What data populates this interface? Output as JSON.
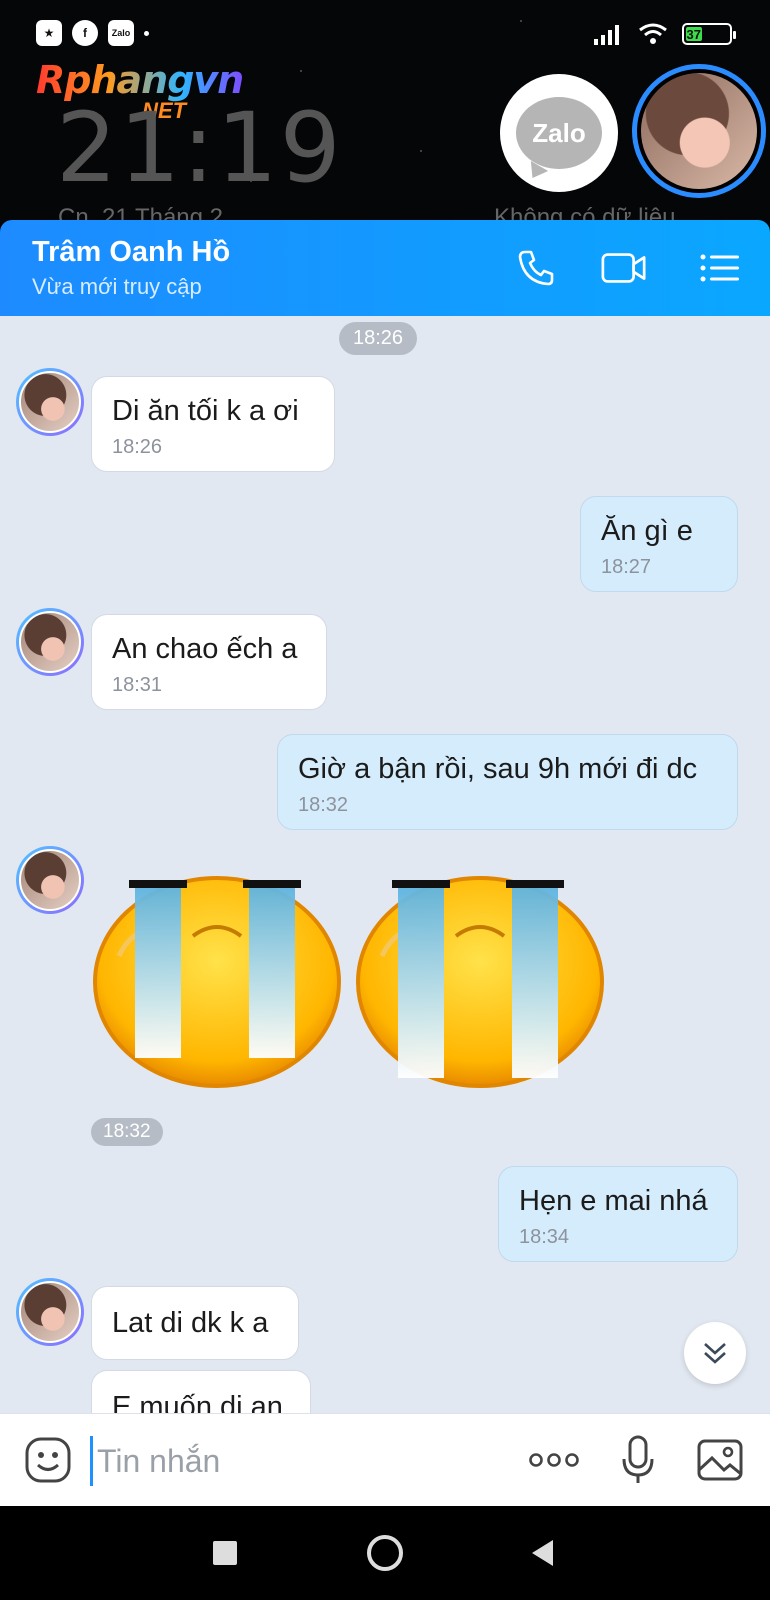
{
  "status_bar": {
    "battery_level": "37",
    "battery_fraction": 0.37,
    "left_icons": [
      "star-app-icon",
      "facebook-icon",
      "zalo-small-icon"
    ],
    "right_icons": [
      "signal-icon",
      "wifi-icon",
      "battery-icon"
    ]
  },
  "lockscreen": {
    "watermark_main": "Rphangvn",
    "watermark_sub": ".NET",
    "clock": "21:19",
    "date": "Cn, 21 Tháng 2",
    "no_data": "Không có dữ liệu"
  },
  "floating": {
    "zalo_label": "Zalo"
  },
  "header": {
    "contact_name": "Trâm Oanh Hồ",
    "status": "Vừa mới truy cập"
  },
  "messages": [
    {
      "kind": "time",
      "text": "18:26"
    },
    {
      "kind": "in",
      "text": "Di ăn tối k a ơi",
      "time": "18:26"
    },
    {
      "kind": "out",
      "text": "Ăn gì e",
      "time": "18:27"
    },
    {
      "kind": "in",
      "text": "An chao ếch a",
      "time": "18:31"
    },
    {
      "kind": "out",
      "text": "Giờ a bận rồi, sau 9h mới đi dc",
      "time": "18:32"
    },
    {
      "kind": "stickers",
      "time": "18:32",
      "sticker_names": [
        "crying-face-sticker",
        "crying-face-sticker"
      ]
    },
    {
      "kind": "out",
      "text": "Hẹn e mai nhá",
      "time": "18:34"
    },
    {
      "kind": "in",
      "text": "Lat di dk k a",
      "time": ""
    },
    {
      "kind": "in",
      "text": "E muốn di an",
      "time": ""
    }
  ],
  "input": {
    "placeholder": "Tin nhắn"
  },
  "colors": {
    "header_start": "#1d8bff",
    "header_end": "#0aa7ff",
    "chat_bg": "#e2e8f1",
    "incoming_bubble": "#ffffff",
    "outgoing_bubble": "#d5ecfc",
    "accent": "#1e90ff"
  }
}
